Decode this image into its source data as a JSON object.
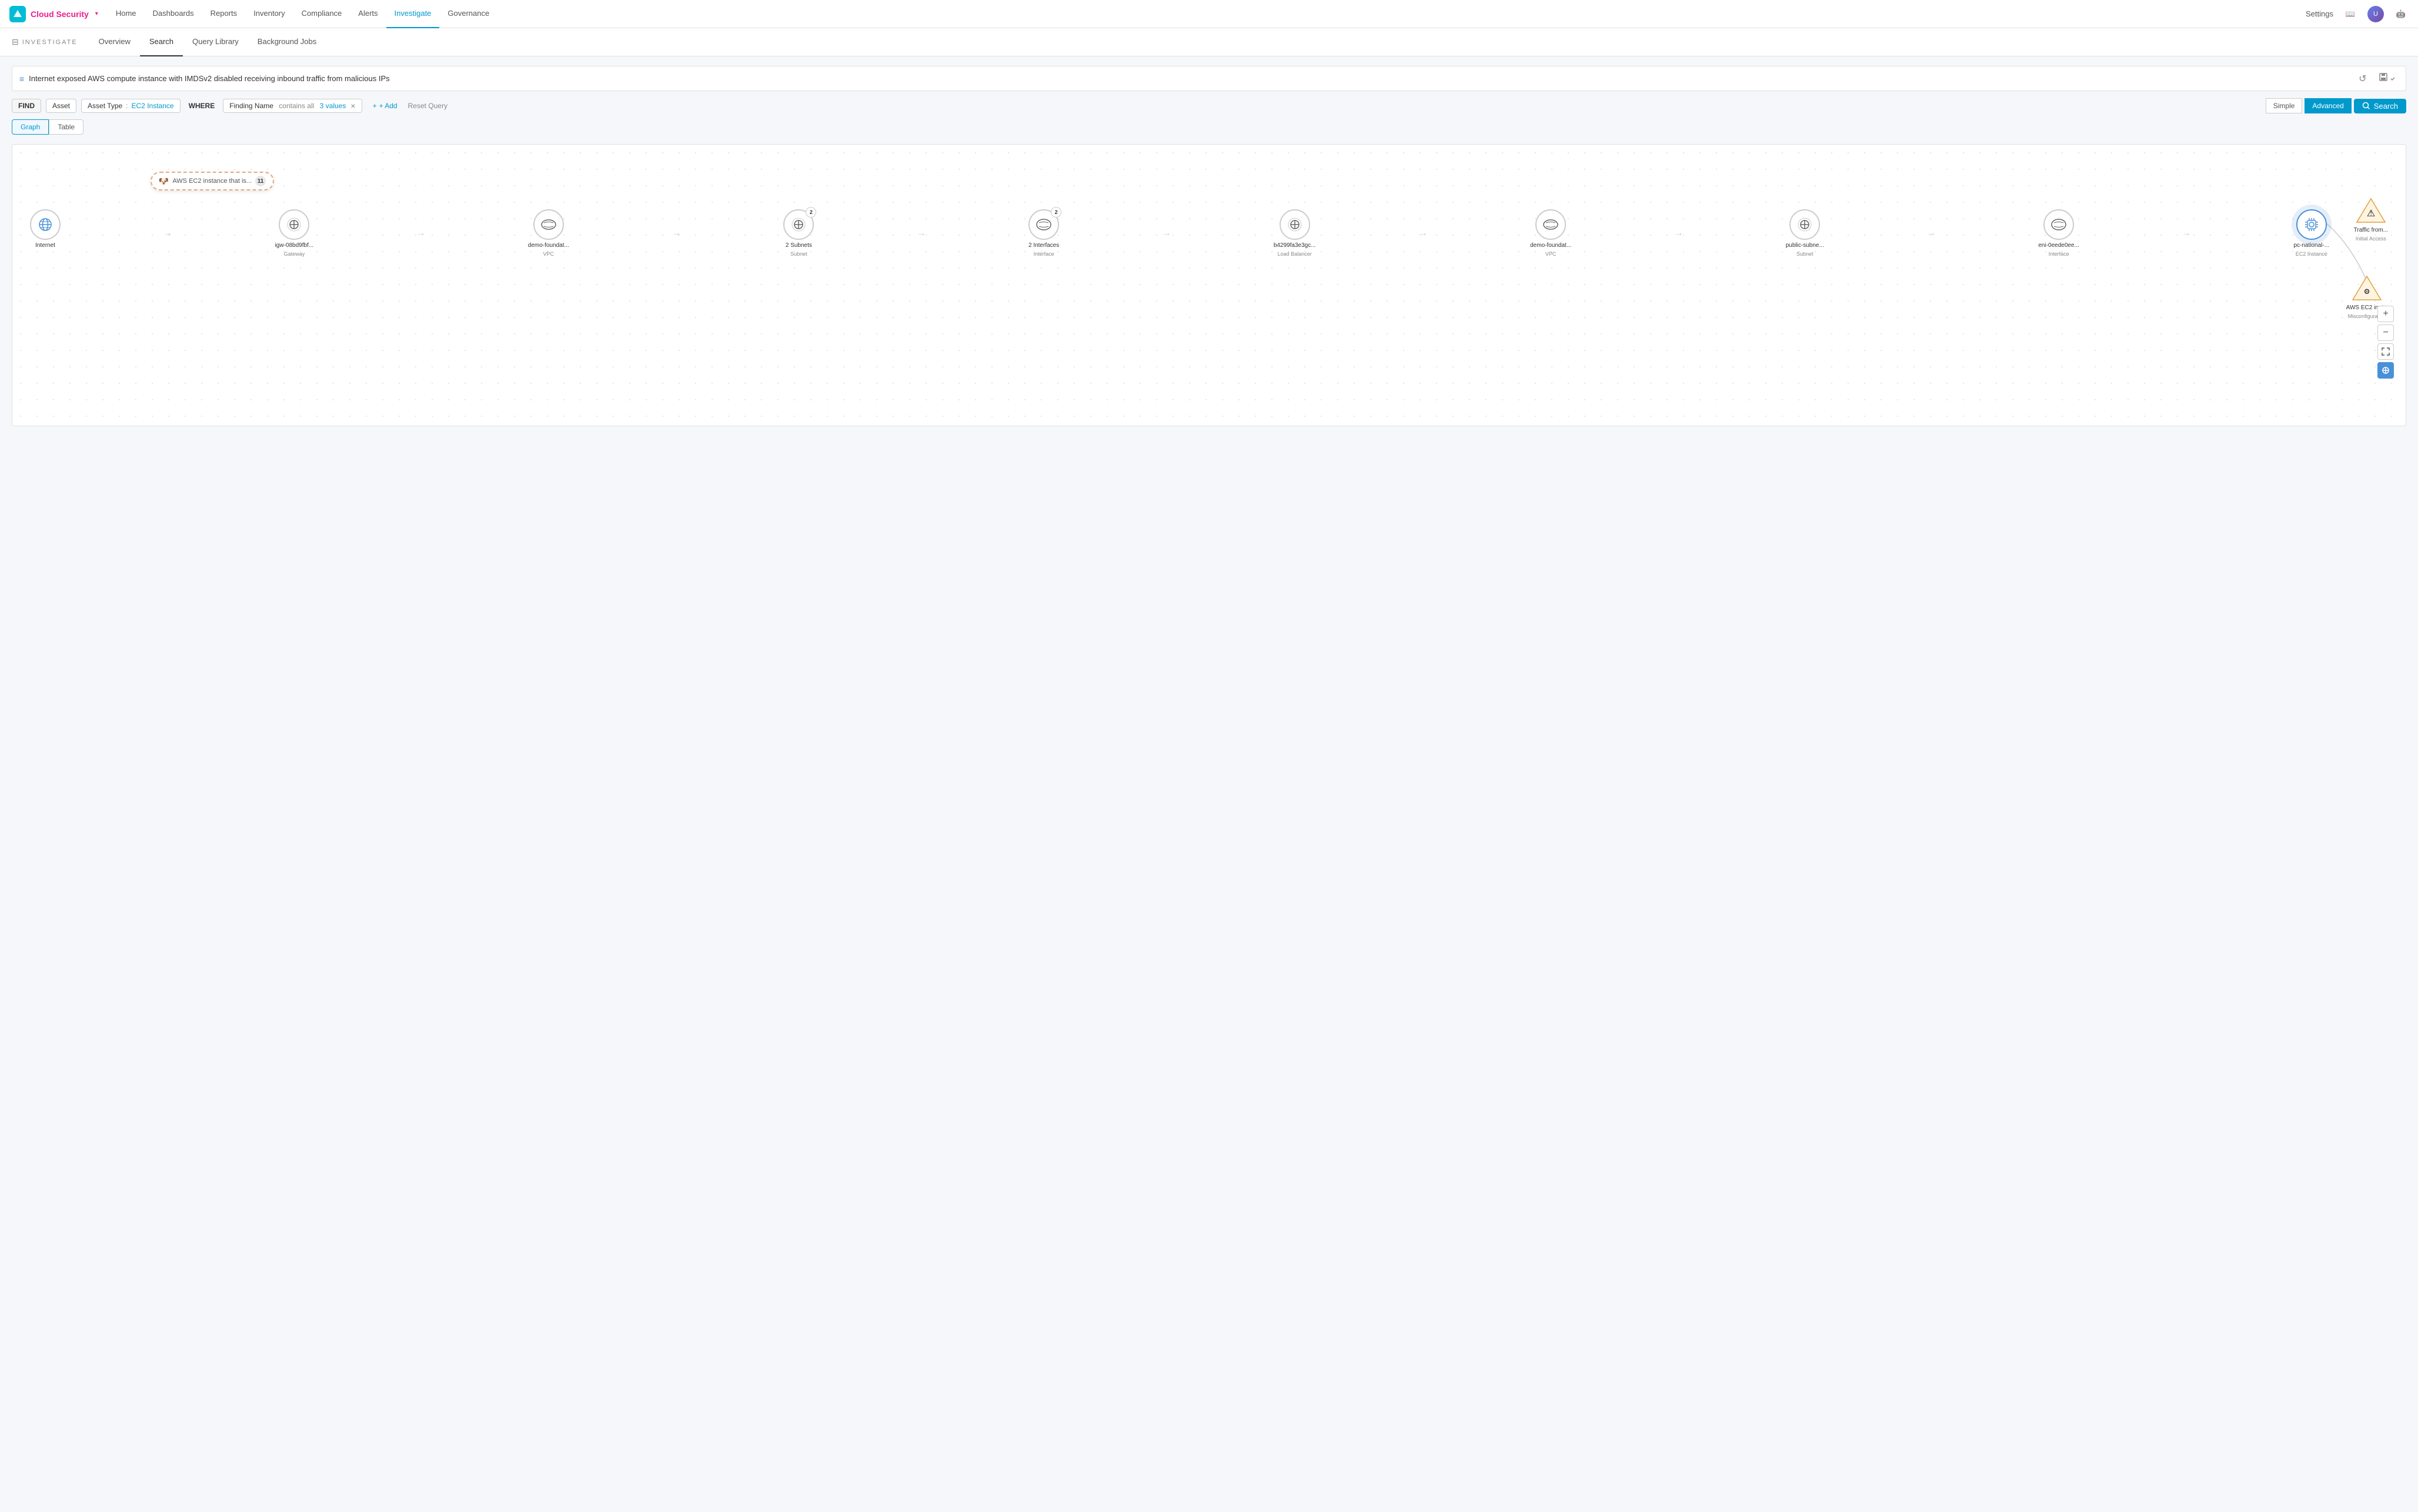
{
  "app": {
    "logo_bg": "#00bcd4",
    "product_name": "Cloud Security",
    "product_name_arrow": "▾"
  },
  "top_nav": {
    "items": [
      {
        "label": "Home",
        "active": false
      },
      {
        "label": "Dashboards",
        "active": false
      },
      {
        "label": "Reports",
        "active": false
      },
      {
        "label": "Inventory",
        "active": false
      },
      {
        "label": "Compliance",
        "active": false
      },
      {
        "label": "Alerts",
        "active": false
      },
      {
        "label": "Investigate",
        "active": true
      },
      {
        "label": "Governance",
        "active": false
      }
    ],
    "settings_label": "Settings",
    "right_icon1": "📖",
    "right_icon2": "🤖"
  },
  "sub_nav": {
    "section_title": "INVESTIGATE",
    "tabs": [
      {
        "label": "Overview",
        "active": false
      },
      {
        "label": "Search",
        "active": true
      },
      {
        "label": "Query Library",
        "active": false
      },
      {
        "label": "Background Jobs",
        "active": false
      }
    ]
  },
  "query_bar": {
    "icon": "≡",
    "text": "Internet exposed AWS compute instance with IMDSv2 disabled receiving inbound traffic from malicious IPs",
    "action_undo": "↺",
    "action_save": "💾"
  },
  "filter_bar": {
    "find_label": "FIND",
    "asset_label": "Asset",
    "asset_type_key": "Asset Type",
    "asset_type_sep": ":",
    "asset_type_val": "EC2 Instance",
    "where_label": "WHERE",
    "finding_name_key": "Finding Name",
    "finding_name_op": "contains all",
    "finding_name_val": "3 values",
    "add_label": "+ Add",
    "reset_label": "Reset Query",
    "simple_label": "Simple",
    "advanced_label": "Advanced",
    "search_label": "Search"
  },
  "view_tabs": {
    "graph_label": "Graph",
    "table_label": "Table"
  },
  "graph": {
    "tooltip": {
      "icon": "🐶",
      "text": "AWS EC2 instance that is...",
      "count": "11"
    },
    "nodes": [
      {
        "id": "internet",
        "icon": "🌐",
        "label": "Internet",
        "sublabel": "",
        "count": null,
        "selected": false
      },
      {
        "id": "gateway",
        "icon": "⊕",
        "label": "igw-08bd9fbf...",
        "sublabel": "Gateway",
        "count": null,
        "selected": false
      },
      {
        "id": "vpc1",
        "icon": "☁",
        "label": "demo-foundat...",
        "sublabel": "VPC",
        "count": null,
        "selected": false
      },
      {
        "id": "subnets",
        "icon": "⊕",
        "label": "2 Subnets",
        "sublabel": "Subnet",
        "count": "2",
        "selected": false
      },
      {
        "id": "interfaces",
        "icon": "☁",
        "label": "2 Interfaces",
        "sublabel": "Interface",
        "count": "2",
        "selected": false
      },
      {
        "id": "loadbalancer",
        "icon": "⊕",
        "label": "b4299fa3e3gc...",
        "sublabel": "Load Balancer",
        "count": null,
        "selected": false
      },
      {
        "id": "vpc2",
        "icon": "☁",
        "label": "demo-foundat...",
        "sublabel": "VPC",
        "count": null,
        "selected": false
      },
      {
        "id": "subnet2",
        "icon": "⊕",
        "label": "public-subne...",
        "sublabel": "Subnet",
        "count": null,
        "selected": false
      },
      {
        "id": "interface2",
        "icon": "☁",
        "label": "eni-0eede0ee...",
        "sublabel": "Interface",
        "count": null,
        "selected": false
      },
      {
        "id": "ec2",
        "icon": "⚙",
        "label": "pc-national-...",
        "sublabel": "EC2 Instance",
        "count": null,
        "selected": true
      }
    ],
    "right_nodes": [
      {
        "id": "traffic",
        "type": "triangle",
        "icon": "⚠",
        "label": "Traffic from...",
        "sublabel": "Initial Access"
      },
      {
        "id": "misconfiguration",
        "type": "triangle",
        "icon": "⚙",
        "label": "AWS EC2 inst...",
        "sublabel": "Misconfiguration"
      }
    ],
    "zoom_controls": [
      {
        "icon": "+",
        "action": "zoom-in",
        "style": "default"
      },
      {
        "icon": "−",
        "action": "zoom-out",
        "style": "default"
      },
      {
        "icon": "⤢",
        "action": "fit",
        "style": "default"
      },
      {
        "icon": "⊕",
        "action": "reset",
        "style": "blue"
      }
    ]
  }
}
